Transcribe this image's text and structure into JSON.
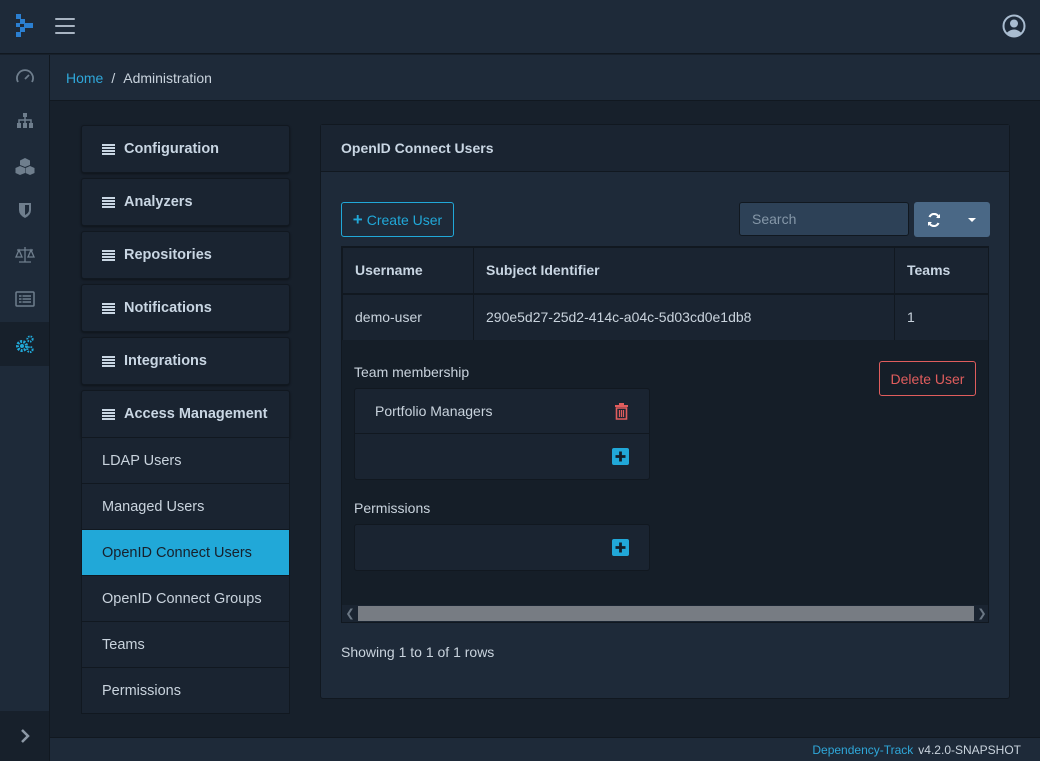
{
  "header": {
    "logo": "dependency-track-logo",
    "menu_icon": "hamburger-icon",
    "user_icon": "user-circle-icon"
  },
  "leftnav": {
    "items": [
      {
        "name": "dashboard",
        "icon": "tachometer-icon"
      },
      {
        "name": "projects",
        "icon": "sitemap-icon"
      },
      {
        "name": "components",
        "icon": "cubes-icon"
      },
      {
        "name": "vulnerabilities",
        "icon": "shield-icon"
      },
      {
        "name": "licenses",
        "icon": "balance-scale-icon"
      },
      {
        "name": "tags",
        "icon": "list-alt-icon"
      },
      {
        "name": "administration",
        "icon": "cogs-icon",
        "active": true
      }
    ],
    "toggle_icon": "chevron-right-icon"
  },
  "breadcrumb": {
    "home": "Home",
    "separator": "/",
    "current": "Administration"
  },
  "sidemenu": {
    "groups": [
      {
        "label": "Configuration"
      },
      {
        "label": "Analyzers"
      },
      {
        "label": "Repositories"
      },
      {
        "label": "Notifications"
      },
      {
        "label": "Integrations"
      },
      {
        "label": "Access Management",
        "open": true
      }
    ],
    "access_items": [
      {
        "label": "LDAP Users"
      },
      {
        "label": "Managed Users"
      },
      {
        "label": "OpenID Connect Users",
        "active": true
      },
      {
        "label": "OpenID Connect Groups"
      },
      {
        "label": "Teams"
      },
      {
        "label": "Permissions"
      }
    ]
  },
  "card": {
    "title": "OpenID Connect Users",
    "create_button": "Create User",
    "search_placeholder": "Search",
    "table": {
      "columns": [
        "Username",
        "Subject Identifier",
        "Teams"
      ],
      "rows": [
        {
          "username": "demo-user",
          "subject_identifier": "290e5d27-25d2-414c-a04c-5d03cd0e1db8",
          "teams": "1"
        }
      ]
    },
    "detail": {
      "team_membership_label": "Team membership",
      "teams": [
        "Portfolio Managers"
      ],
      "permissions_label": "Permissions",
      "delete_button": "Delete User"
    },
    "showing": "Showing 1 to 1 of 1 rows"
  },
  "footer": {
    "app_name": "Dependency-Track",
    "version": "v4.2.0-SNAPSHOT"
  },
  "colors": {
    "accent": "#21a8d8",
    "danger": "#e05d5d",
    "background": "#17202b",
    "panel": "#1e2a39"
  }
}
